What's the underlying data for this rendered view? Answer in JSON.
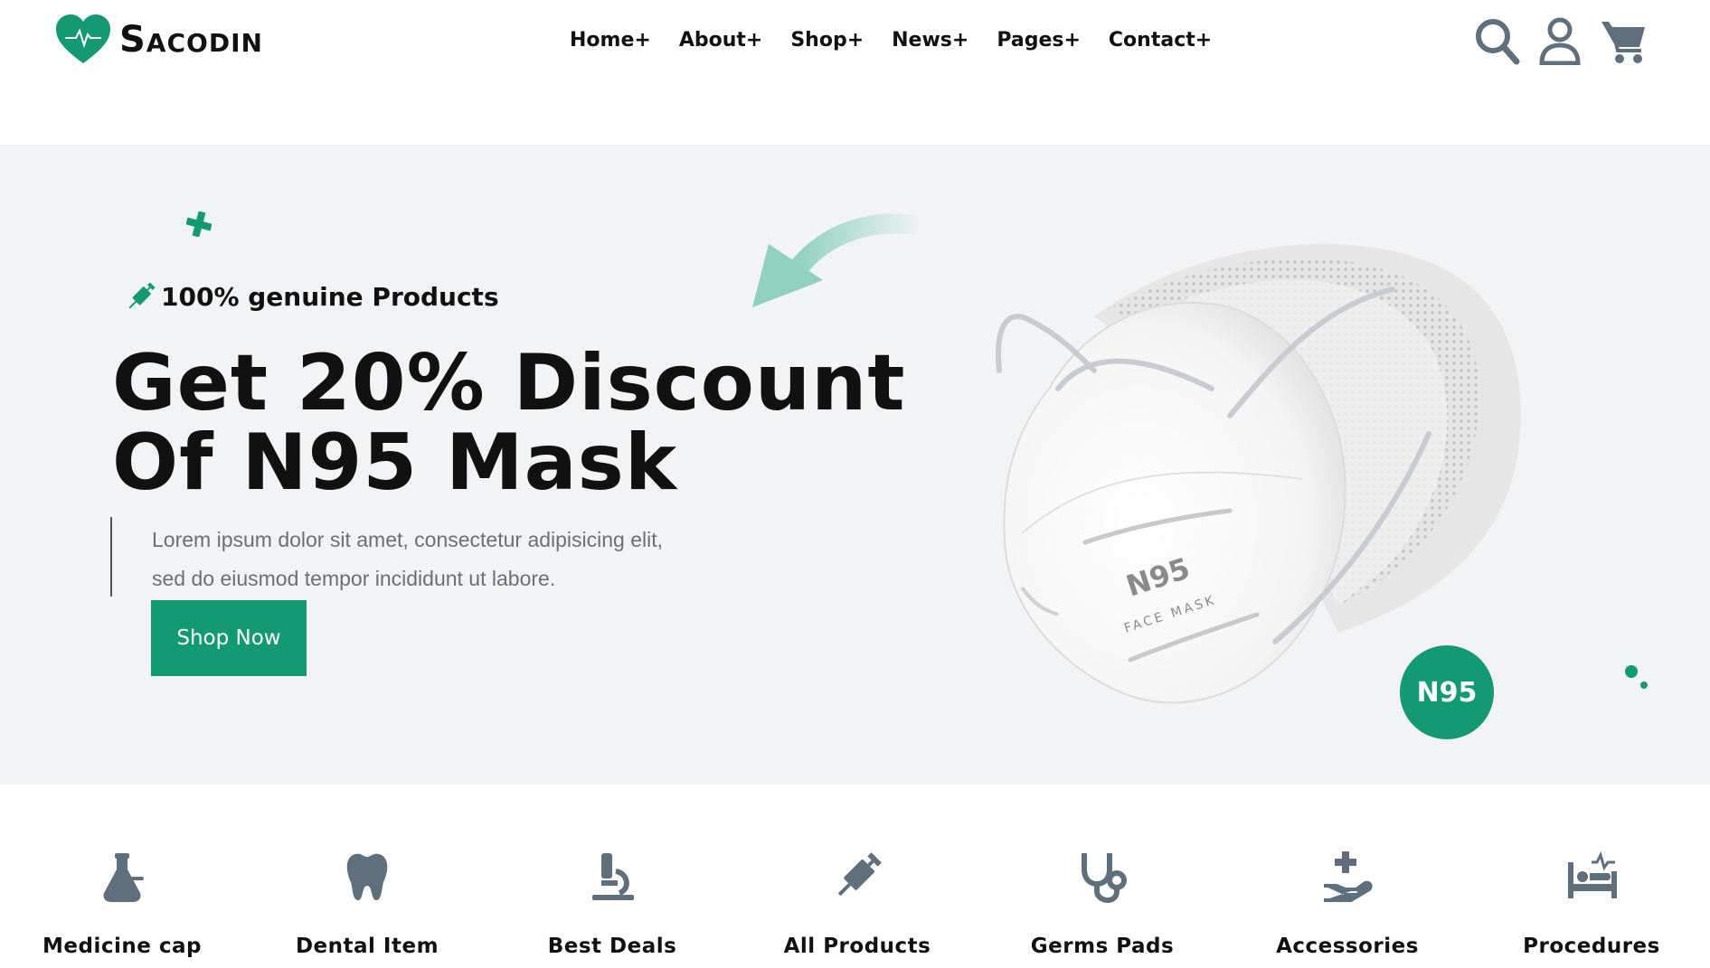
{
  "header": {
    "logo_text": "Sacodin",
    "nav": [
      "Home+",
      "About+",
      "Shop+",
      "News+",
      "Pages+",
      "Contact+"
    ],
    "icons": [
      "search-icon",
      "user-icon",
      "cart-icon"
    ]
  },
  "hero": {
    "tagline": "100% genuine Products",
    "title_line1": "Get 20% Discount",
    "title_line2": "Of N95 Mask",
    "desc_line1": "Lorem ipsum dolor sit amet, consectetur adipisicing elit,",
    "desc_line2": "sed do eiusmod tempor incididunt ut labore.",
    "button": "Shop Now",
    "badge": "N95",
    "mask_print_1": "N95",
    "mask_print_2": "FACE MASK"
  },
  "categories": [
    {
      "label": "Medicine cap",
      "icon": "flask-icon"
    },
    {
      "label": "Dental Item",
      "icon": "tooth-icon"
    },
    {
      "label": "Best Deals",
      "icon": "microscope-icon"
    },
    {
      "label": "All Products",
      "icon": "syringe-icon"
    },
    {
      "label": "Germs Pads",
      "icon": "stethoscope-icon"
    },
    {
      "label": "Accessories",
      "icon": "hand-medical-icon"
    },
    {
      "label": "Procedures",
      "icon": "hospital-bed-icon"
    }
  ],
  "colors": {
    "accent": "#139a72",
    "hero_bg": "#f2f3f5",
    "icon_gray": "#5f6f7d"
  }
}
